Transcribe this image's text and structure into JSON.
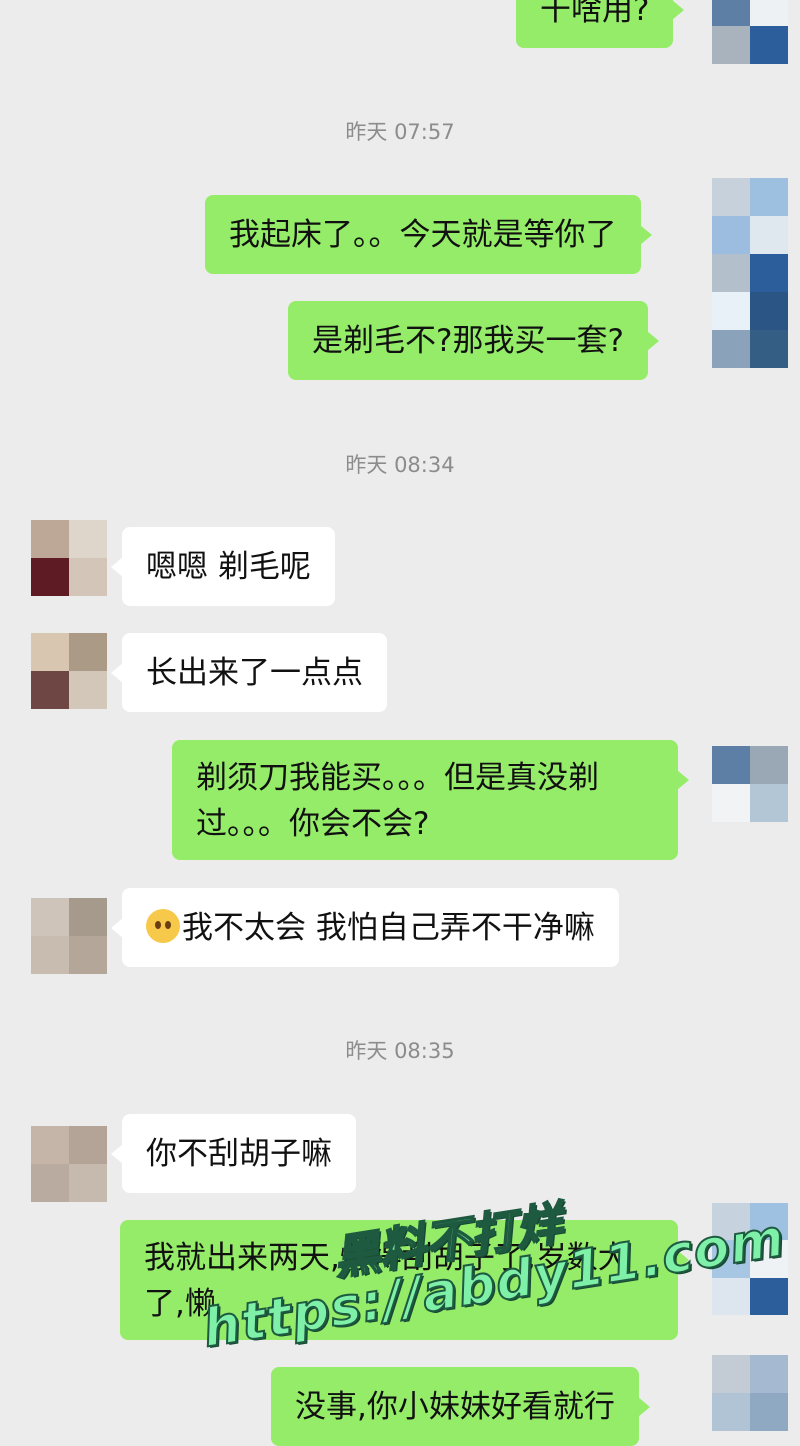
{
  "timestamps": [
    "昨天 07:57",
    "昨天 08:34",
    "昨天 08:35"
  ],
  "messages": [
    {
      "side": "right",
      "text": "干啥用?"
    },
    {
      "side": "right",
      "text": "我起床了。。今天就是等你了"
    },
    {
      "side": "right",
      "text": "是剃毛不?那我买一套?"
    },
    {
      "side": "left",
      "text": "嗯嗯 剃毛呢"
    },
    {
      "side": "left",
      "text": "长出来了一点点"
    },
    {
      "side": "right",
      "text": "剃须刀我能买。。。但是真没剃过。。。你会不会?"
    },
    {
      "side": "left",
      "emoji": "crying-face-icon",
      "text": "我不太会 我怕自己弄不干净嘛"
    },
    {
      "side": "left",
      "text": "你不刮胡子嘛"
    },
    {
      "side": "right",
      "text": "我就出来两天,懒得刮胡子了,岁数大了,懒"
    },
    {
      "side": "right",
      "text": "没事,你小妹妹好看就行"
    }
  ],
  "watermark": {
    "line1": "黑料不打烊",
    "line2": "https://abdy11.com"
  },
  "colors": {
    "background": "#ececec",
    "sent_bubble": "#95ec69",
    "received_bubble": "#ffffff",
    "timestamp": "#8c8c8c"
  }
}
